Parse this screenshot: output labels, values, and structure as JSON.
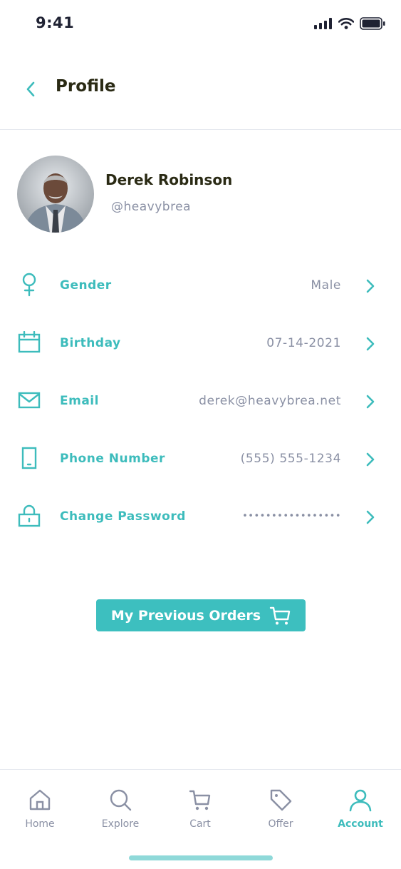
{
  "status_bar": {
    "time": "9:41"
  },
  "header": {
    "title": "Profile"
  },
  "profile": {
    "name": "Derek Robinson",
    "handle": "@heavybrea"
  },
  "rows": [
    {
      "icon": "female-gender-icon",
      "label": "Gender",
      "value": "Male"
    },
    {
      "icon": "calendar-icon",
      "label": "Birthday",
      "value": "07-14-2021"
    },
    {
      "icon": "mail-icon",
      "label": "Email",
      "value": "derek@heavybrea.net"
    },
    {
      "icon": "phone-icon",
      "label": "Phone Number",
      "value": "(555) 555-1234"
    },
    {
      "icon": "lock-icon",
      "label": "Change Password",
      "value": "•••••••••••••••••"
    }
  ],
  "orders_button": {
    "label": "My Previous Orders",
    "icon": "cart-icon"
  },
  "tabs": [
    {
      "icon": "home-icon",
      "label": "Home",
      "active": false
    },
    {
      "icon": "search-icon",
      "label": "Explore",
      "active": false
    },
    {
      "icon": "cart-icon",
      "label": "Cart",
      "active": false
    },
    {
      "icon": "tag-icon",
      "label": "Offer",
      "active": false
    },
    {
      "icon": "user-icon",
      "label": "Account",
      "active": true
    }
  ],
  "colors": {
    "accent": "#3dbfbf",
    "muted": "#8a90a4",
    "title": "#2a2a14"
  }
}
